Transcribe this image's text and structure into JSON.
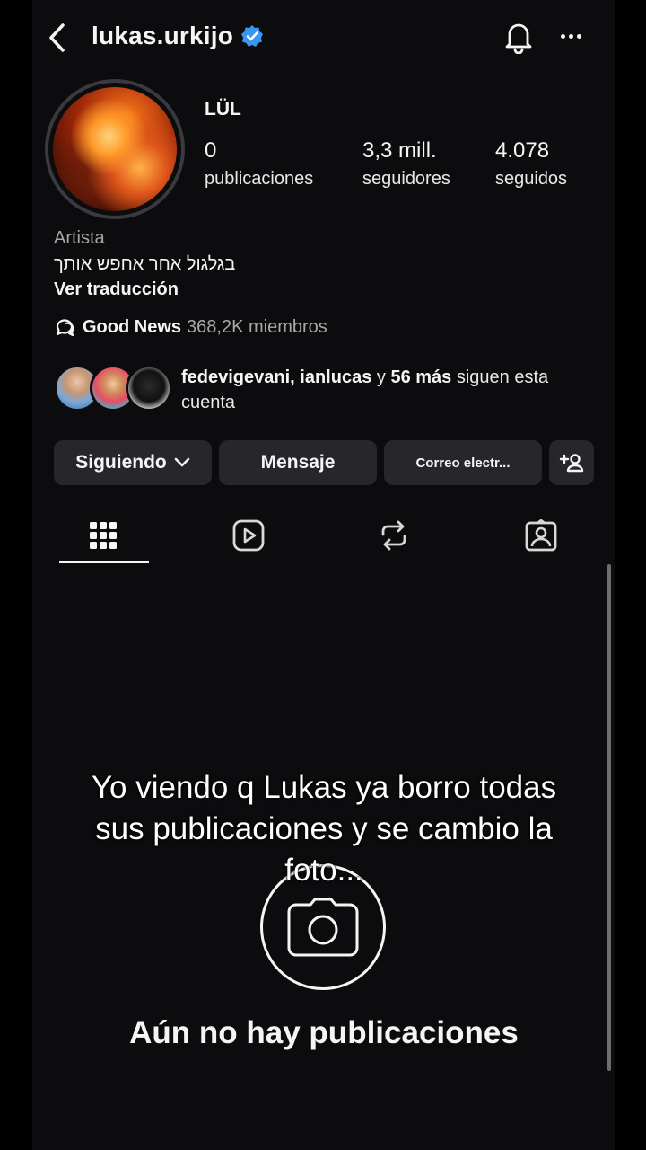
{
  "header": {
    "username": "lukas.urkijo",
    "verified_icon": "verified-badge-icon",
    "back_icon": "chevron-left-icon",
    "bell_icon": "bell-icon",
    "more_icon": "more-horizontal-icon"
  },
  "profile": {
    "display_name": "LÜL",
    "stats": [
      {
        "value": "0",
        "label": "publicaciones"
      },
      {
        "value": "3,3 mill.",
        "label": "seguidores"
      },
      {
        "value": "4.078",
        "label": "seguidos"
      }
    ],
    "category": "Artista",
    "bio": "בגלגול אחר אחפש אותך",
    "translate_label": "Ver traducción",
    "community": {
      "name": "Good News",
      "members": "368,2K miembros"
    },
    "followed_by": {
      "names": "fedevigevani, ianlucas",
      "connector": "y",
      "more": "56 más",
      "suffix": "siguen esta cuenta"
    }
  },
  "actions": {
    "following_label": "Siguiendo",
    "message_label": "Mensaje",
    "email_label": "Correo electr...",
    "add_user_icon": "add-user-icon"
  },
  "tabs": [
    {
      "name": "grid",
      "icon": "grid-icon",
      "active": true
    },
    {
      "name": "reels",
      "icon": "reels-icon",
      "active": false
    },
    {
      "name": "reposts",
      "icon": "repost-icon",
      "active": false
    },
    {
      "name": "tagged",
      "icon": "tagged-icon",
      "active": false
    }
  ],
  "content": {
    "overlay_caption": "Yo viendo q Lukas ya borro todas sus publicaciones y se cambio la foto...",
    "empty_title": "Aún no hay publicaciones",
    "camera_icon": "camera-icon"
  },
  "colors": {
    "background": "#0c0c0e",
    "button": "#27272b",
    "verified": "#3897f0",
    "muted_text": "#a8a8a8"
  }
}
